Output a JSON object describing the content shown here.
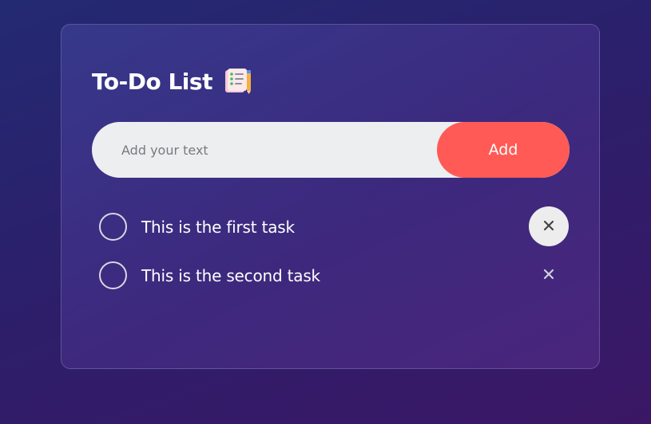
{
  "app": {
    "title": "To-Do List",
    "title_icon": "notepad-pencil-icon"
  },
  "input": {
    "placeholder": "Add your text",
    "value": ""
  },
  "add_button": {
    "label": "Add",
    "color": "#ff5a55"
  },
  "tasks": [
    {
      "text": "This is the first task",
      "checked": false,
      "delete_icon": "close-icon"
    },
    {
      "text": "This is the second task",
      "checked": false,
      "delete_icon": "close-icon"
    }
  ],
  "colors": {
    "background_start": "#232a72",
    "background_end": "#3b1766",
    "accent": "#ff5a55",
    "input_background": "#edeef0"
  }
}
